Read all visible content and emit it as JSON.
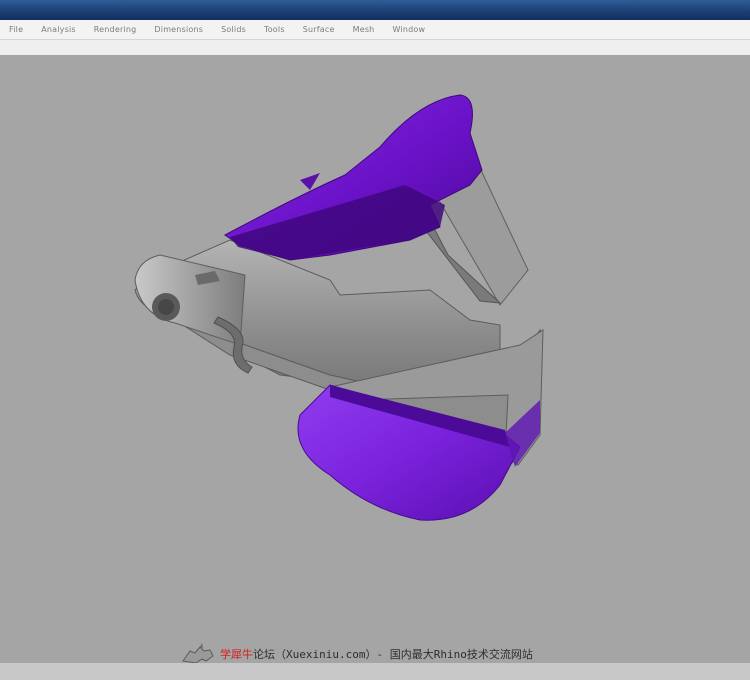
{
  "window": {
    "title": ""
  },
  "menu": {
    "items": [
      {
        "label": "File"
      },
      {
        "label": "Analysis"
      },
      {
        "label": "Rendering"
      },
      {
        "label": "Dimensions"
      },
      {
        "label": "Solids"
      },
      {
        "label": "Tools"
      },
      {
        "label": "Surface"
      },
      {
        "label": "Mesh"
      },
      {
        "label": "Window"
      }
    ]
  },
  "viewport": {
    "background": "#a5a5a5",
    "model_color": "#7a1fd6",
    "metal_color": "#8f8f8f"
  },
  "watermark": {
    "brand": "学犀牛",
    "text": "论坛（Xuexiniu.com）- 国内最大Rhino技术交流网站"
  }
}
